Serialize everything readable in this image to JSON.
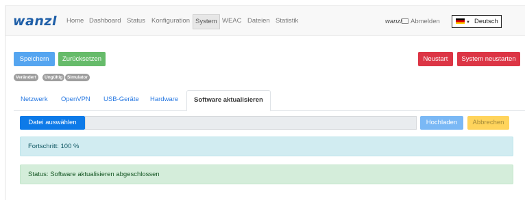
{
  "navbar": {
    "logo": "wanzl",
    "items": [
      {
        "label": "Home"
      },
      {
        "label": "Dashboard"
      },
      {
        "label": "Status"
      },
      {
        "label": "Konfiguration"
      },
      {
        "label": "System",
        "active": true
      },
      {
        "label": "WEAC"
      },
      {
        "label": "Dateien"
      },
      {
        "label": "Statistik"
      }
    ],
    "user": "wanzl",
    "logout_label": "Abmelden",
    "language": "Deutsch"
  },
  "toolbar": {
    "save_label": "Speichern",
    "reset_label": "Zurücksetzen",
    "restart_label": "Neustart",
    "system_restart_label": "System neustarten"
  },
  "badges": [
    "Verändert",
    "Ungültig",
    "Simulator"
  ],
  "tabs": [
    {
      "label": "Netzwerk"
    },
    {
      "label": "OpenVPN"
    },
    {
      "label": "USB-Geräte"
    },
    {
      "label": "Hardware"
    },
    {
      "label": "Software aktualisieren",
      "active": true
    }
  ],
  "upload": {
    "choose_file_label": "Datei auswählen",
    "file_path": "",
    "upload_label": "Hochladen",
    "cancel_label": "Abbrechen"
  },
  "progress_text": "Fortschritt: 100 %",
  "status_text": "Status: Software aktualisieren abgeschlossen",
  "colors": {
    "brand": "#1f5fa8",
    "primary": "#0d7ae8",
    "success": "#66bb6a",
    "danger": "#dc3545",
    "warning": "#ffd45c",
    "info_bg": "#d1ecf1",
    "success_bg": "#d4edda"
  }
}
